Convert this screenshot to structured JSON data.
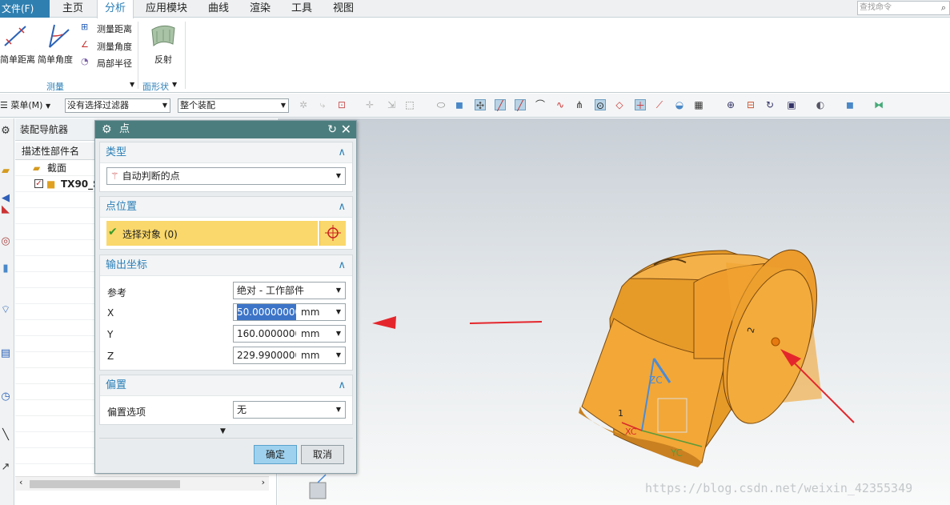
{
  "menubar": {
    "file_label": "文件(F)",
    "tabs": [
      "主页",
      "分析",
      "应用模块",
      "曲线",
      "渲染",
      "工具",
      "视图"
    ],
    "active_tab": "分析",
    "search_placeholder": "查找命令"
  },
  "ribbon": {
    "simple_distance": "简单距离",
    "simple_angle": "简单角度",
    "measure_distance": "测量距离",
    "measure_angle": "测量角度",
    "local_radius": "局部半径",
    "reflection": "反射",
    "group_measure": "测量",
    "group_surface": "面形状"
  },
  "toolbar": {
    "menu_label": "菜单(M)",
    "filter_value": "没有选择过滤器",
    "assembly_value": "整个装配"
  },
  "navigator": {
    "title": "装配导航器",
    "column_header": "描述性部件名",
    "rows": [
      {
        "label": "截面"
      },
      {
        "label": "TX90_S"
      }
    ]
  },
  "dialog": {
    "title": "点",
    "type_section": "类型",
    "type_value": "自动判断的点",
    "location_section": "点位置",
    "select_object": "选择对象 (0)",
    "output_section": "输出坐标",
    "reference_label": "参考",
    "reference_value": "绝对 - 工作部件",
    "x_label": "X",
    "x_value": "50.00000000",
    "y_label": "Y",
    "y_value": "160.0000000",
    "z_label": "Z",
    "z_value": "229.9900000",
    "unit": "mm",
    "offset_section": "偏置",
    "offset_option_label": "偏置选项",
    "offset_option_value": "无",
    "ok": "确定",
    "cancel": "取消"
  },
  "viewport": {
    "axis_zc": "ZC",
    "axis_yc": "YC",
    "axis_xc": "XC",
    "label_1": "1",
    "label_2": "2"
  },
  "watermark": "https://blog.csdn.net/weixin_42355349",
  "colors": {
    "accent": "#2a7fb8",
    "dialog_title": "#4b7d7e",
    "selection_row": "#fad86b",
    "part": "#f0a32c",
    "arrow": "#e4262c"
  }
}
